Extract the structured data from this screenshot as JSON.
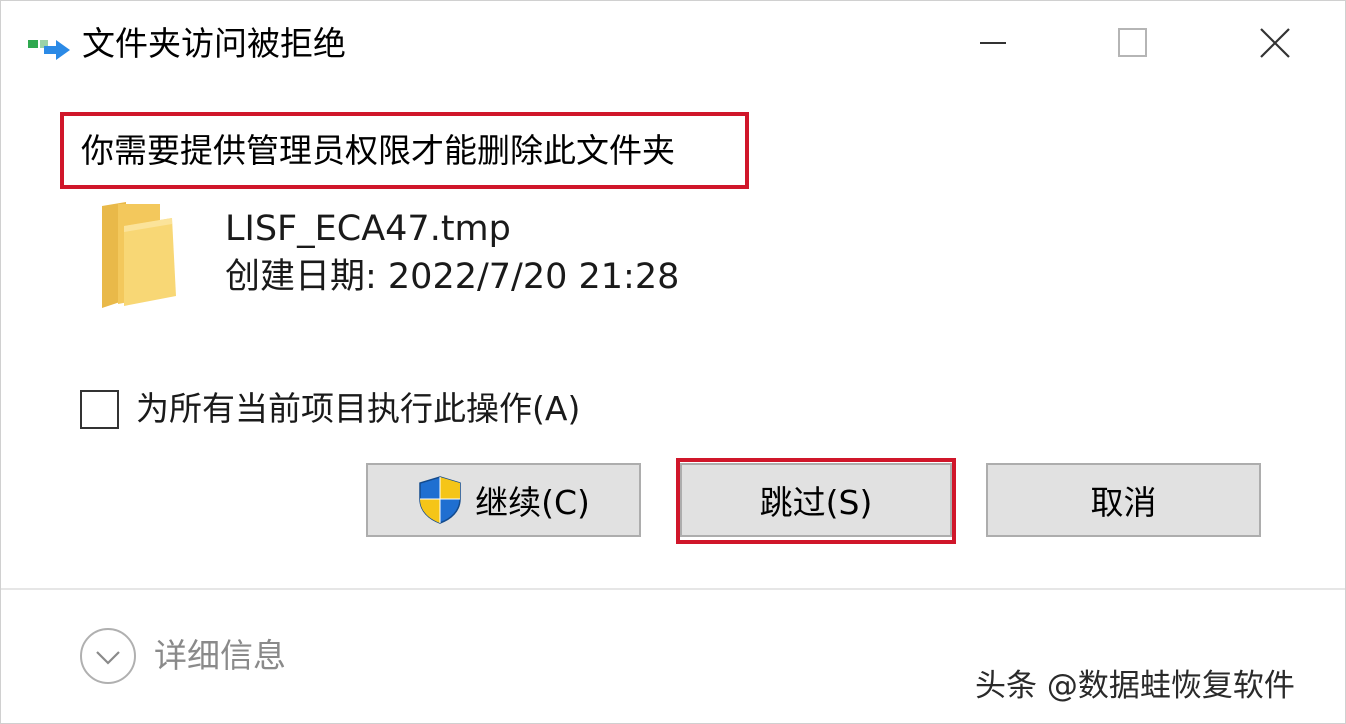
{
  "window": {
    "title": "文件夹访问被拒绝",
    "app_icon": "folder-move-icon",
    "controls": {
      "minimize": "minimize-icon",
      "maximize": "maximize-icon",
      "close": "close-icon"
    }
  },
  "message": "你需要提供管理员权限才能删除此文件夹",
  "file": {
    "icon": "folder-icon",
    "name": "LISF_ECA47.tmp",
    "created": "创建日期: 2022/7/20 21:28"
  },
  "apply_all": {
    "label": "为所有当前项目执行此操作(A)",
    "checked": false
  },
  "buttons": {
    "continue": "继续(C)",
    "skip": "跳过(S)",
    "cancel": "取消"
  },
  "details": {
    "label": "详细信息",
    "icon": "chevron-down-icon"
  },
  "watermark": "头条 @数据蛙恢复软件",
  "colors": {
    "highlight": "#d0162a",
    "button_bg": "#e1e1e1",
    "button_border": "#adadad",
    "folder": "#f8d775",
    "shield_blue": "#1f6fd1",
    "shield_yellow": "#f5c518"
  }
}
